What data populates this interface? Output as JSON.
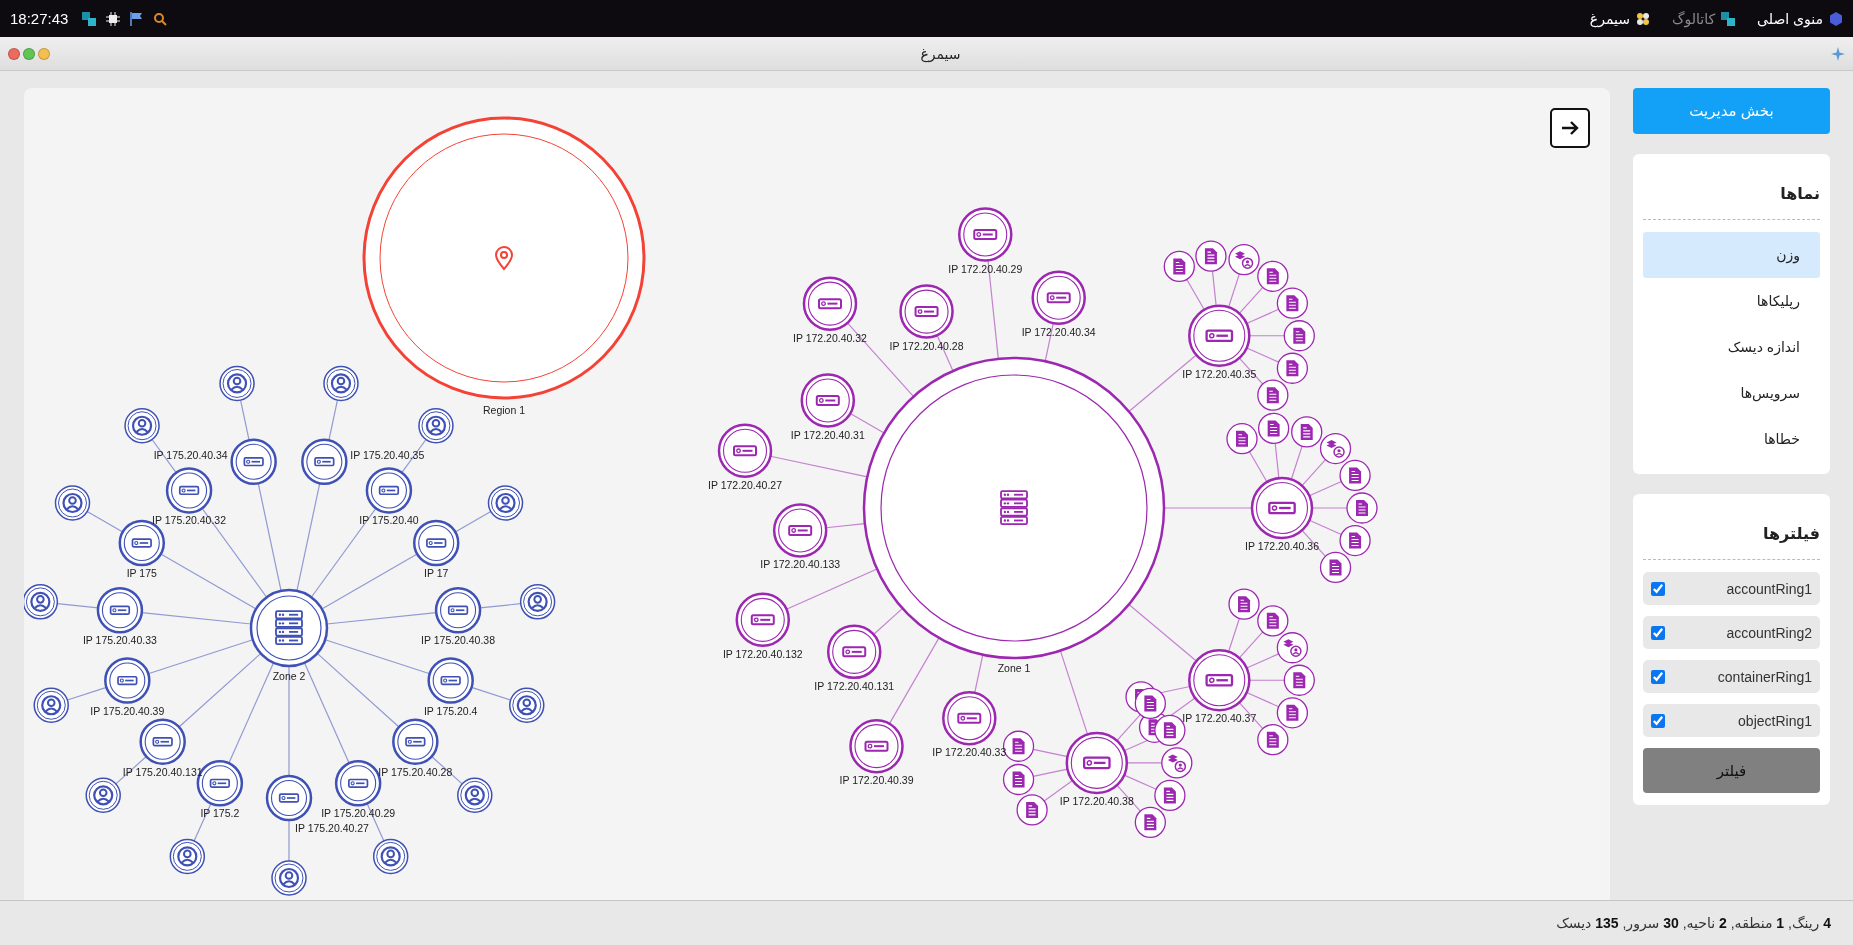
{
  "top_bar": {
    "time": "18:27:43",
    "menu": [
      {
        "label": "منوی اصلی",
        "disabled": false
      },
      {
        "label": "کاتالوگ",
        "disabled": true
      },
      {
        "label": "سیمرغ",
        "disabled": false
      }
    ]
  },
  "window": {
    "title": "سیمرغ"
  },
  "graph": {
    "region": {
      "label": "Region 1"
    },
    "zones": [
      {
        "label": "Zone 2",
        "color": "#3f51b5",
        "servers": [
          {
            "label": "IP 175.20.40.34",
            "children": [
              {
                "kind": "user"
              }
            ]
          },
          {
            "label": "IP 175.20.40.35",
            "children": [
              {
                "kind": "user"
              }
            ]
          },
          {
            "label": "IP 175.20.40.32",
            "children": [
              {
                "kind": "user"
              }
            ]
          },
          {
            "label": "IP 175.20.40",
            "children": [
              {
                "kind": "user"
              }
            ]
          },
          {
            "label": "IP 175",
            "children": [
              {
                "kind": "user"
              }
            ]
          },
          {
            "label": "IP 17",
            "children": [
              {
                "kind": "user"
              }
            ]
          },
          {
            "label": "IP 175.20.40.33",
            "children": [
              {
                "kind": "user"
              }
            ]
          },
          {
            "label": "IP 175.20.40.38",
            "children": [
              {
                "kind": "user"
              }
            ]
          },
          {
            "label": "IP 175.20.40.39",
            "children": [
              {
                "kind": "user"
              }
            ]
          },
          {
            "label": "IP 175.20.4",
            "children": [
              {
                "kind": "user"
              }
            ]
          },
          {
            "label": "IP 175.20.40.131",
            "children": [
              {
                "kind": "user"
              }
            ]
          },
          {
            "label": "IP 175.20.40.28",
            "children": [
              {
                "kind": "user"
              }
            ]
          },
          {
            "label": "IP 175.2",
            "children": [
              {
                "kind": "user"
              }
            ]
          },
          {
            "label": "IP 175.20.40.29",
            "children": [
              {
                "kind": "user"
              }
            ]
          },
          {
            "label": "IP 175.20.40.27",
            "children": [
              {
                "kind": "user"
              }
            ]
          }
        ]
      },
      {
        "label": "Zone 1",
        "color": "#9c27b0",
        "servers": [
          {
            "label": "IP 172.20.40.34"
          },
          {
            "label": "IP 172.20.40.29"
          },
          {
            "label": "IP 172.20.40.28"
          },
          {
            "label": "IP 172.20.40.32"
          },
          {
            "label": "IP 172.20.40.31"
          },
          {
            "label": "IP 172.20.40.27"
          },
          {
            "label": "IP 172.20.40.133"
          },
          {
            "label": "IP 172.20.40.132"
          },
          {
            "label": "IP 172.20.40.131"
          },
          {
            "label": "IP 172.20.40.39"
          },
          {
            "label": "IP 172.20.40.33"
          },
          {
            "label": "IP 172.20.40.35",
            "children": [
              {
                "kind": "disk"
              },
              {
                "kind": "disk"
              },
              {
                "kind": "disk"
              },
              {
                "kind": "disk"
              },
              {
                "kind": "disk"
              },
              {
                "kind": "account"
              },
              {
                "kind": "disk"
              },
              {
                "kind": "disk"
              }
            ]
          },
          {
            "label": "IP 172.20.40.36",
            "children": [
              {
                "kind": "disk"
              },
              {
                "kind": "disk"
              },
              {
                "kind": "disk"
              },
              {
                "kind": "disk"
              },
              {
                "kind": "disk"
              },
              {
                "kind": "disk"
              },
              {
                "kind": "account"
              },
              {
                "kind": "disk"
              }
            ]
          },
          {
            "label": "IP 172.20.40.37",
            "children": [
              {
                "kind": "disk"
              },
              {
                "kind": "disk"
              },
              {
                "kind": "disk"
              },
              {
                "kind": "disk"
              },
              {
                "kind": "disk"
              },
              {
                "kind": "disk"
              },
              {
                "kind": "disk"
              },
              {
                "kind": "account"
              }
            ]
          },
          {
            "label": "IP 172.20.40.38",
            "children": [
              {
                "kind": "account"
              },
              {
                "kind": "disk"
              },
              {
                "kind": "disk"
              },
              {
                "kind": "disk"
              },
              {
                "kind": "disk"
              },
              {
                "kind": "disk"
              },
              {
                "kind": "disk"
              },
              {
                "kind": "disk"
              }
            ]
          }
        ]
      }
    ]
  },
  "sidebar": {
    "admin_button": "بخش مدیریت",
    "views": {
      "title": "نماها",
      "items": [
        {
          "label": "وزن",
          "selected": true
        },
        {
          "label": "رپلیکاها",
          "selected": false
        },
        {
          "label": "اندازه دیسک",
          "selected": false
        },
        {
          "label": "سرویس‌ها",
          "selected": false
        },
        {
          "label": "خطاها",
          "selected": false
        }
      ]
    },
    "filters": {
      "title": "فیلترها",
      "items": [
        {
          "label": "accountRing1",
          "checked": true
        },
        {
          "label": "accountRing2",
          "checked": true
        },
        {
          "label": "containerRing1",
          "checked": true
        },
        {
          "label": "objectRing1",
          "checked": true
        }
      ],
      "button": "فیلتر"
    }
  },
  "status_bar": "**4** رینگ, **1** منطقه, **2** ناحیه, **30** سرور, **135** دیسک"
}
